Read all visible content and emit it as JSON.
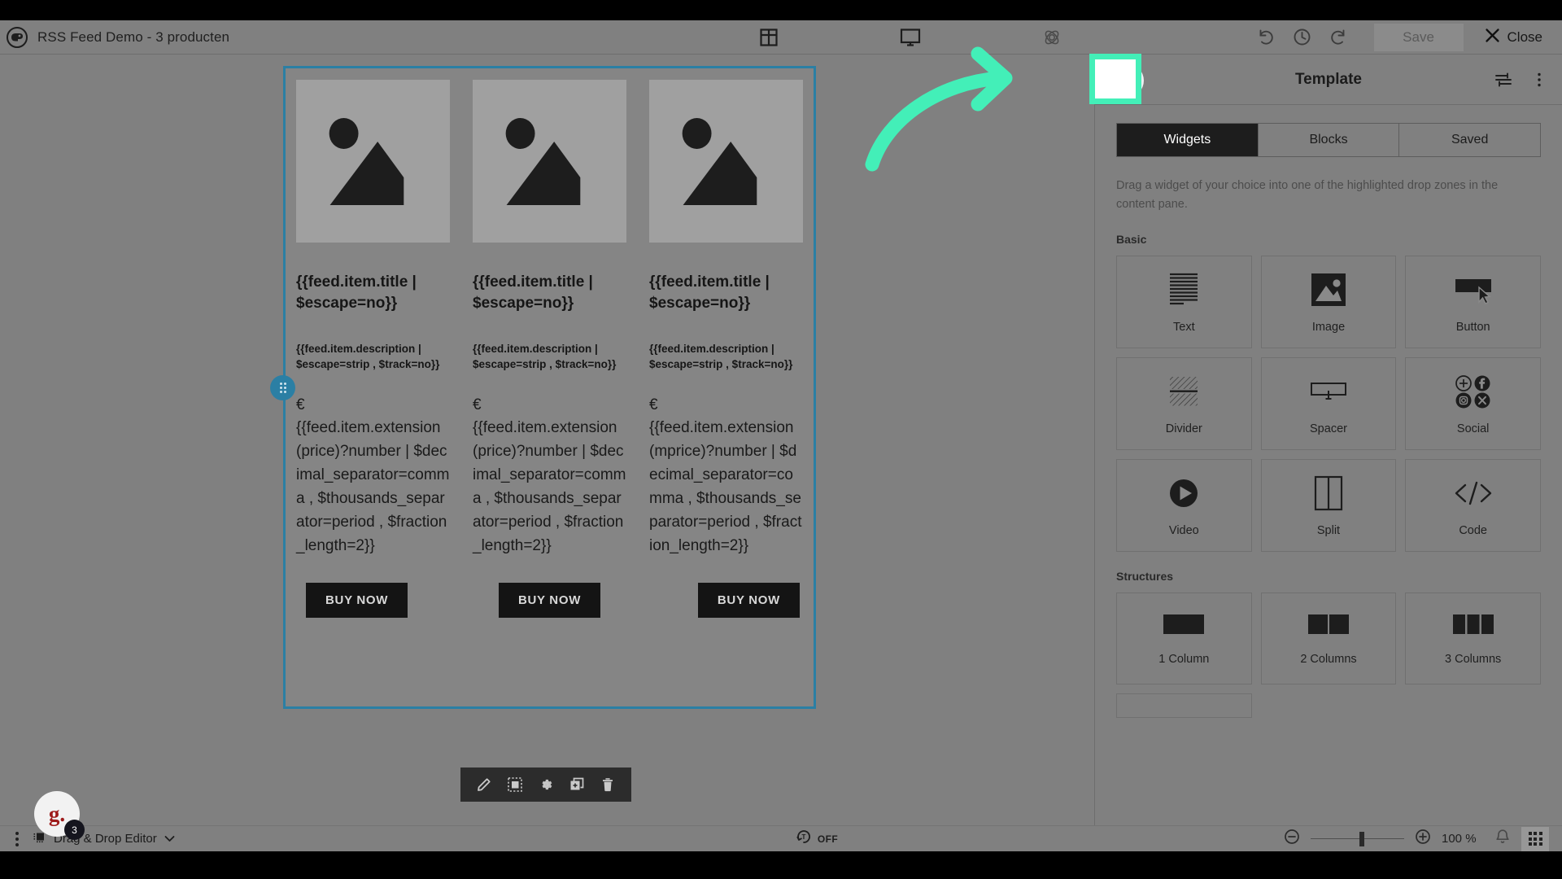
{
  "topbar": {
    "logo_icon": "rss-chameleon-logo-icon",
    "title": "RSS Feed Demo - 3 producten",
    "center_icons": [
      {
        "name": "layout-grid-icon",
        "label": "Layout"
      },
      {
        "name": "desktop-preview-icon",
        "label": "Desktop preview"
      },
      {
        "name": "atom-settings-icon",
        "label": "Settings"
      }
    ],
    "undo_label": "Undo",
    "history_label": "History",
    "redo_label": "Redo",
    "save_label": "Save",
    "close_label": "Close"
  },
  "canvas": {
    "selected_block": {
      "columns": 3,
      "cards": [
        {
          "image_alt": "image placeholder",
          "title": "{{feed.item.title | $escape=no}}",
          "description": "{{feed.item.description | $escape=strip , $track=no}}",
          "currency": "€",
          "price": "{{feed.item.extension(price)?number | $decimal_separator=comma , $thousands_separator=period , $fraction_length=2}}",
          "cta": "BUY NOW"
        },
        {
          "image_alt": "image placeholder",
          "title": "{{feed.item.title | $escape=no}}",
          "description": "{{feed.item.description | $escape=strip , $track=no}}",
          "currency": "€",
          "price": "{{feed.item.extension(price)?number | $decimal_separator=comma , $thousands_separator=period , $fraction_length=2}}",
          "cta": "BUY NOW"
        },
        {
          "image_alt": "image placeholder",
          "title": "{{feed.item.title | $escape=no}}",
          "description": "{{feed.item.description | $escape=strip , $track=no}}",
          "currency": "€",
          "price": "{{feed.item.extension(mprice)?number | $decimal_separator=comma , $thousands_separator=period , $fraction_length=2}}",
          "cta": "BUY NOW"
        }
      ]
    },
    "block_toolbar": [
      {
        "name": "edit-pencil-icon",
        "label": "Edit"
      },
      {
        "name": "select-block-icon",
        "label": "Select"
      },
      {
        "name": "settings-gear-icon",
        "label": "Settings"
      },
      {
        "name": "duplicate-icon",
        "label": "Duplicate"
      },
      {
        "name": "delete-trash-icon",
        "label": "Delete"
      }
    ],
    "selection_color": "#2b7fa4"
  },
  "sidebar": {
    "back_label": "Back",
    "title": "Template",
    "header_icons": [
      {
        "name": "sliders-settings-icon",
        "label": "Settings"
      },
      {
        "name": "more-vertical-icon",
        "label": "More options"
      }
    ],
    "tabs": [
      {
        "label": "Widgets",
        "active": true
      },
      {
        "label": "Blocks",
        "active": false
      },
      {
        "label": "Saved",
        "active": false
      }
    ],
    "hint": "Drag a widget of your choice into one of the highlighted drop zones in the content pane.",
    "basic_label": "Basic",
    "widgets": [
      {
        "label": "Text",
        "icon": "text-lines-icon"
      },
      {
        "label": "Image",
        "icon": "image-icon"
      },
      {
        "label": "Button",
        "icon": "button-cursor-icon"
      },
      {
        "label": "Divider",
        "icon": "divider-icon"
      },
      {
        "label": "Spacer",
        "icon": "spacer-icon"
      },
      {
        "label": "Social",
        "icon": "social-icons-icon"
      },
      {
        "label": "Video",
        "icon": "video-play-icon"
      },
      {
        "label": "Split",
        "icon": "split-icon"
      },
      {
        "label": "Code",
        "icon": "code-brackets-icon"
      }
    ],
    "structures_label": "Structures",
    "structures": [
      {
        "label": "1 Column",
        "icon": "one-column-icon"
      },
      {
        "label": "2 Columns",
        "icon": "two-columns-icon"
      },
      {
        "label": "3 Columns",
        "icon": "three-columns-icon"
      }
    ]
  },
  "bottombar": {
    "kebab_label": "More",
    "editor_name": "Drag & Drop Editor",
    "editor_icon": "editor-chip-icon",
    "tracking_icon": "tracking-toggle-icon",
    "tracking_state": "OFF",
    "zoom_out_label": "Zoom out",
    "zoom_in_label": "Zoom in",
    "zoom_level": "100 %",
    "bell_label": "Notifications",
    "apps_label": "Apps"
  },
  "avatar": {
    "initials": "g.",
    "badge_count": "3"
  },
  "annotation": {
    "arrow_color": "#43efb8",
    "highlight_target": "sidebar-back-button"
  }
}
